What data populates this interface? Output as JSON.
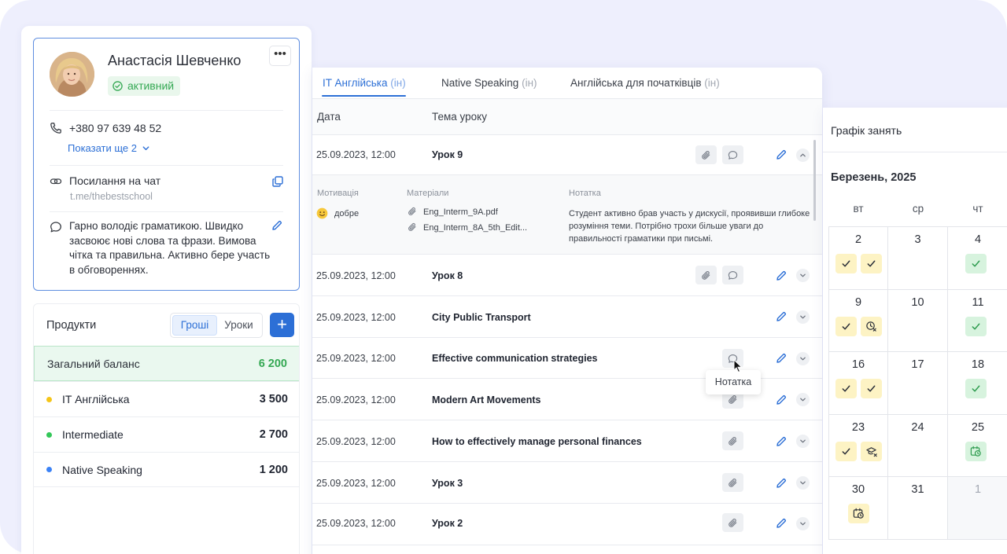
{
  "profile": {
    "name": "Анастасія Шевченко",
    "status": "активний",
    "phone": "+380 97 639 48 52",
    "show_more": "Показати ще 2",
    "chat_label": "Посилання на чат",
    "chat_link": "t.me/thebestschool",
    "note": "Гарно володіє граматикою. Швидко засвоює нові слова та фрази. Вимова чітка та правильна. Активно бере участь в обговореннях.",
    "more_icon": "more-horizontal-icon"
  },
  "products": {
    "title": "Продукти",
    "toggle": [
      "Гроші",
      "Уроки"
    ],
    "toggle_selected": "Гроші",
    "add_icon": "plus-icon",
    "balance_label": "Загальний баланс",
    "balance_value": "6 200",
    "items": [
      {
        "name": "IT Англійська",
        "value": "3 500",
        "color": "#f5c518"
      },
      {
        "name": "Intermediate",
        "value": "2 700",
        "color": "#34c759"
      },
      {
        "name": "Native Speaking",
        "value": "1 200",
        "color": "#3b82f6"
      }
    ]
  },
  "lessons": {
    "tabs": [
      {
        "label": "IT Англійська",
        "suffix": "(ін)"
      },
      {
        "label": "Native Speaking",
        "suffix": "(ін)"
      },
      {
        "label": "Англійська для початківців",
        "suffix": "(ін)"
      }
    ],
    "active_tab": "IT Англійська",
    "col_date": "Дата",
    "col_topic": "Тема уроку",
    "rows": [
      {
        "date": "25.09.2023, 12:00",
        "topic": "Урок 9"
      },
      {
        "date": "25.09.2023, 12:00",
        "topic": "Урок 8"
      },
      {
        "date": "25.09.2023, 12:00",
        "topic": "City Public Transport"
      },
      {
        "date": "25.09.2023, 12:00",
        "topic": "Effective communication strategies"
      },
      {
        "date": "25.09.2023, 12:00",
        "topic": "Modern Art Movements"
      },
      {
        "date": "25.09.2023, 12:00",
        "topic": "How to effectively manage personal finances"
      },
      {
        "date": "25.09.2023, 12:00",
        "topic": "Урок 3"
      },
      {
        "date": "25.09.2023, 12:00",
        "topic": "Урок 2"
      }
    ],
    "expanded": {
      "motivation_label": "Мотивація",
      "motivation_value": "добре",
      "materials_label": "Матеріали",
      "materials": [
        "Eng_Interm_9A.pdf",
        "Eng_Interm_8A_5th_Edit..."
      ],
      "note_label": "Нотатка",
      "note_value": "Студент активно брав участь у дискусії, проявивши глибоке розуміння теми. Потрібно трохи більше уваги до правильності граматики при письмі."
    },
    "tooltip": "Нотатка"
  },
  "schedule": {
    "title": "Графік занять",
    "month": "Березень, 2025",
    "weekdays": [
      "вт",
      "ср",
      "чт"
    ],
    "weeks": [
      [
        "2",
        "3",
        "4"
      ],
      [
        "9",
        "10",
        "11"
      ],
      [
        "16",
        "17",
        "18"
      ],
      [
        "23",
        "24",
        "25"
      ],
      [
        "30",
        "31",
        "1"
      ]
    ]
  }
}
